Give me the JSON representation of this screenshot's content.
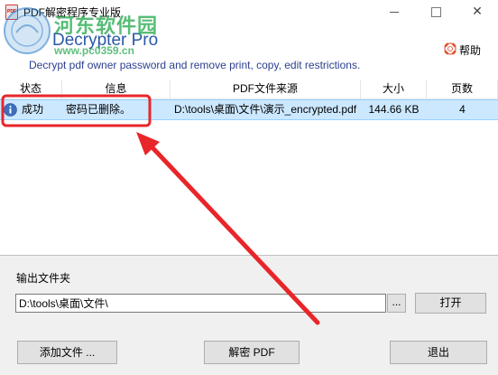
{
  "window": {
    "title": "PDF解密程序专业版",
    "icon": "pdf-app-icon",
    "controls": {
      "minimize": "minimize-icon",
      "maximize": "maximize-icon",
      "close_glyph": "✕"
    }
  },
  "watermark": {
    "site_name": "河东软件园",
    "url": "www.pc0359.cn",
    "icon": "watermark-seal-icon"
  },
  "header": {
    "logo_text": "Decrypter Pro",
    "tagline": "Decrypt pdf owner password and remove print, copy, edit  restrictions.",
    "help_label": "帮助",
    "help_icon": "lifebuoy-icon"
  },
  "table": {
    "columns": [
      "状态",
      "信息",
      "PDF文件来源",
      "大小",
      "页数"
    ],
    "rows": [
      {
        "status_icon": "info-icon",
        "status": "成功",
        "info": "密码已删除。",
        "source": "D:\\tools\\桌面\\文件\\演示_encrypted.pdf",
        "size": "144.66 KB",
        "pages": "4"
      }
    ]
  },
  "output": {
    "label": "输出文件夹",
    "path": "D:\\tools\\桌面\\文件\\",
    "browse_label": "...",
    "open_label": "打开"
  },
  "buttons": {
    "add_files": "添加文件 ...",
    "decrypt": "解密 PDF",
    "exit": "退出"
  },
  "colors": {
    "selection_bg": "#cce8ff",
    "selection_border": "#99d1ff",
    "logo": "#2a59a8",
    "tagline": "#2b3f8f",
    "annotation": "#e8262a",
    "watermark_green": "#28aa50"
  },
  "annotation": {
    "highlight_box": "red-highlight-box",
    "arrow": "red-arrow"
  }
}
